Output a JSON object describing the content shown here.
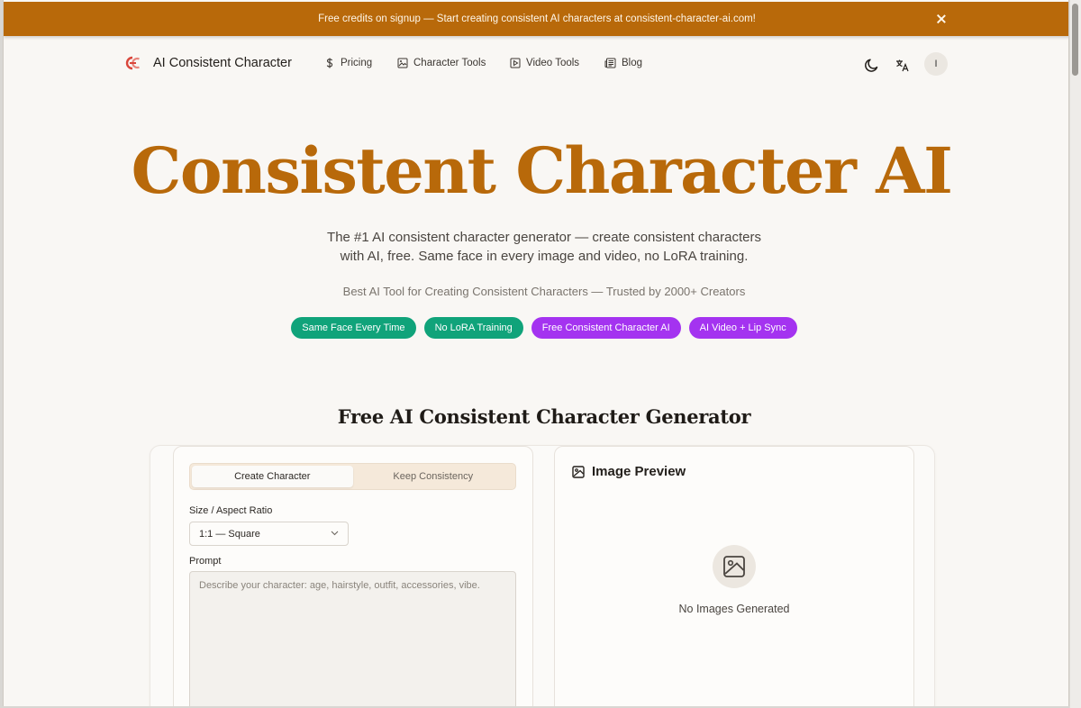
{
  "banner": {
    "text": "Free credits on signup — Start creating consistent AI characters at consistent-character-ai.com!",
    "close_icon": "close-icon"
  },
  "nav": {
    "brand": "AI Consistent Character",
    "items": [
      {
        "label": "Pricing",
        "icon": "dollar-icon"
      },
      {
        "label": "Character Tools",
        "icon": "image-box-icon"
      },
      {
        "label": "Video Tools",
        "icon": "play-box-icon"
      },
      {
        "label": "Blog",
        "icon": "newspaper-icon"
      }
    ],
    "theme_icon": "moon-icon",
    "language_icon": "translate-icon",
    "avatar_initial": "I"
  },
  "hero": {
    "title": "Consistent Character AI",
    "subtitle_line1": "The #1 AI consistent character generator — create consistent characters",
    "subtitle_line2": "with AI, free. Same face in every image and video, no LoRA training.",
    "tagline": "Best AI Tool for Creating Consistent Characters — Trusted by 2000+ Creators",
    "pills": [
      "Same Face Every Time",
      "No LoRA Training",
      "Free Consistent Character AI",
      "AI Video + Lip Sync"
    ]
  },
  "generator": {
    "title": "Free AI Consistent Character Generator",
    "tabs": [
      "Create Character",
      "Keep Consistency"
    ],
    "size_label": "Size / Aspect Ratio",
    "size_value": "1:1 — Square",
    "prompt_label": "Prompt",
    "prompt_placeholder": "Describe your character: age, hairstyle, outfit, accessories, vibe.",
    "preview_title": "Image Preview",
    "preview_empty": "No Images Generated"
  },
  "colors": {
    "brand": "#b8690a",
    "pill_green": "#10a37a",
    "pill_purple": "#a433f0"
  }
}
